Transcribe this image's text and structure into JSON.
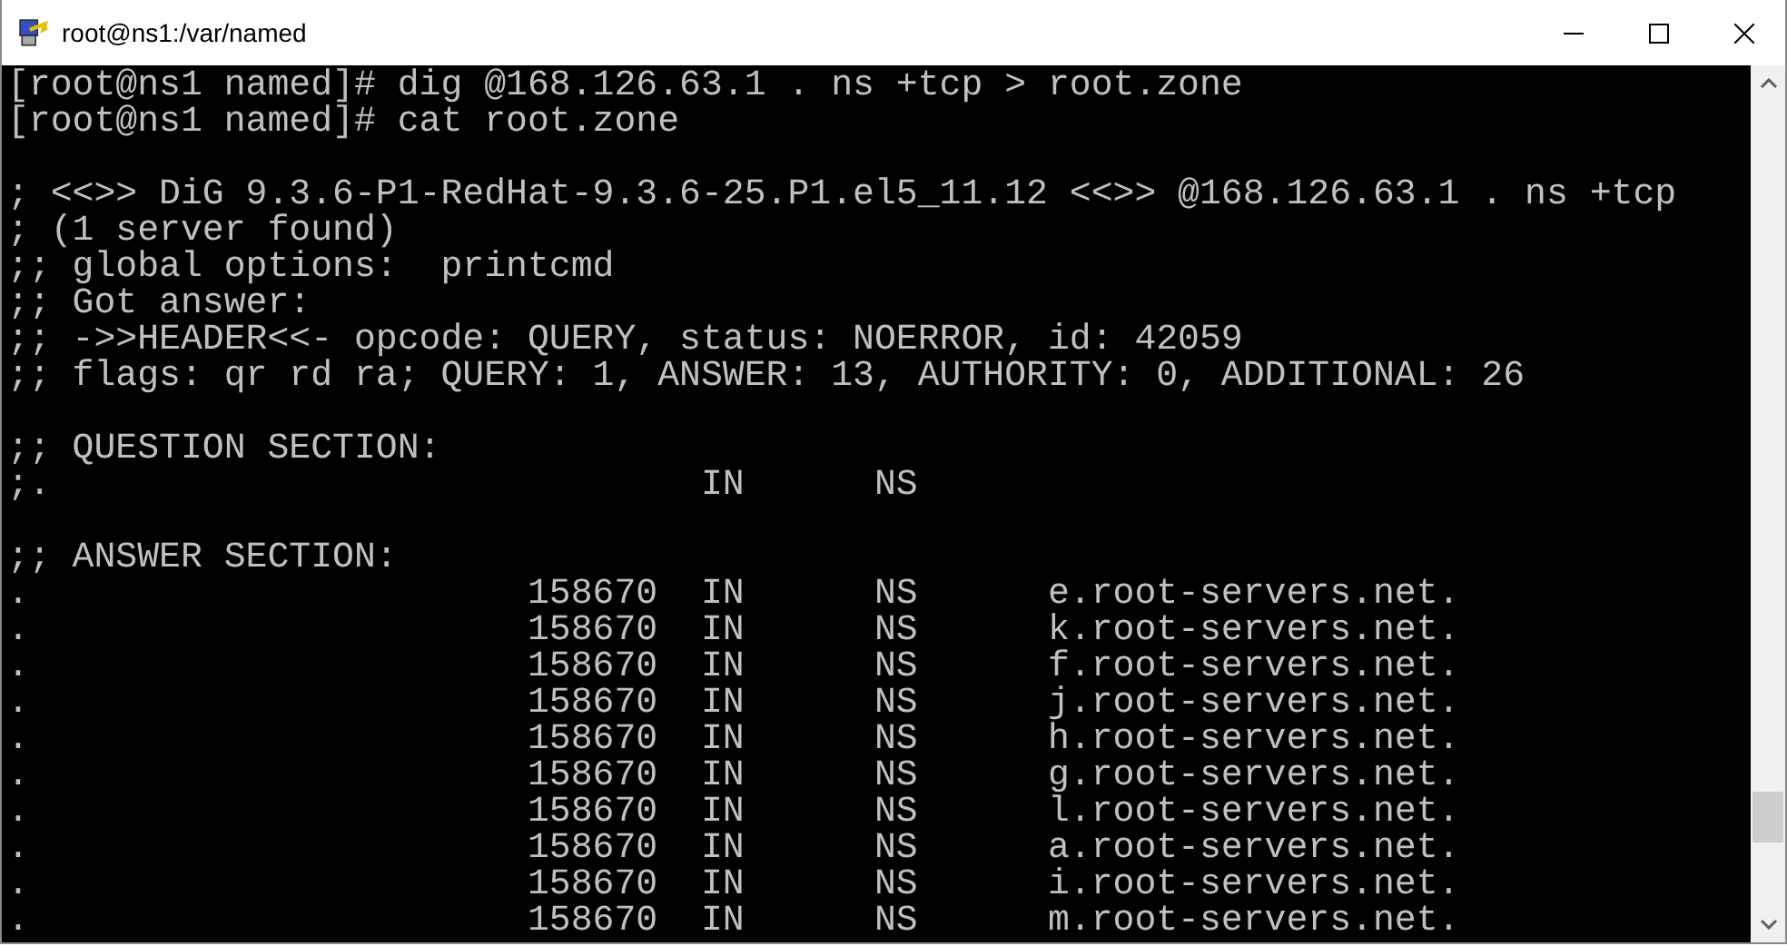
{
  "window": {
    "title": "root@ns1:/var/named"
  },
  "terminal": {
    "blocks": [
      [
        "[root@ns1 named]# dig @168.126.63.1 . ns +tcp > root.zone",
        "[root@ns1 named]# cat root.zone"
      ],
      [
        "; <<>> DiG 9.3.6-P1-RedHat-9.3.6-25.P1.el5_11.12 <<>> @168.126.63.1 . ns +tcp",
        "; (1 server found)",
        ";; global options:  printcmd",
        ";; Got answer:",
        ";; ->>HEADER<<- opcode: QUERY, status: NOERROR, id: 42059",
        ";; flags: qr rd ra; QUERY: 1, ANSWER: 13, AUTHORITY: 0, ADDITIONAL: 26"
      ],
      [
        ";; QUESTION SECTION:",
        ";.                              IN      NS"
      ],
      [
        ";; ANSWER SECTION:",
        ".                       158670  IN      NS      e.root-servers.net.",
        ".                       158670  IN      NS      k.root-servers.net.",
        ".                       158670  IN      NS      f.root-servers.net.",
        ".                       158670  IN      NS      j.root-servers.net.",
        ".                       158670  IN      NS      h.root-servers.net.",
        ".                       158670  IN      NS      g.root-servers.net.",
        ".                       158670  IN      NS      l.root-servers.net.",
        ".                       158670  IN      NS      a.root-servers.net.",
        ".                       158670  IN      NS      i.root-servers.net.",
        ".                       158670  IN      NS      m.root-servers.net."
      ]
    ]
  }
}
